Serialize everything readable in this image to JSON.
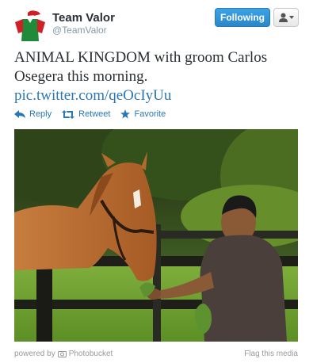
{
  "author": {
    "name": "Team Valor",
    "handle": "@TeamValor",
    "avatar_icon": "jockey-silks-icon",
    "avatar_colors": {
      "body": "#1f8a3a",
      "sleeves": "#cf2027",
      "cap": "#cf2027"
    }
  },
  "header": {
    "follow_label": "Following",
    "user_menu_icon": "user-dropdown-icon"
  },
  "tweet": {
    "text": "ANIMAL KINGDOM with groom Carlos Osegera this morning.",
    "link": "pic.twitter.com/qeOcIyUu"
  },
  "actions": [
    {
      "label": "Reply",
      "icon": "reply-icon"
    },
    {
      "label": "Retweet",
      "icon": "retweet-icon"
    },
    {
      "label": "Favorite",
      "icon": "star-icon"
    }
  ],
  "media": {
    "description_icon": "photo-icon"
  },
  "footer": {
    "powered_by": "powered by",
    "provider": "Photobucket",
    "flag_label": "Flag this media"
  },
  "colors": {
    "link": "#2a77b6",
    "follow_button": "#2b87c7"
  }
}
